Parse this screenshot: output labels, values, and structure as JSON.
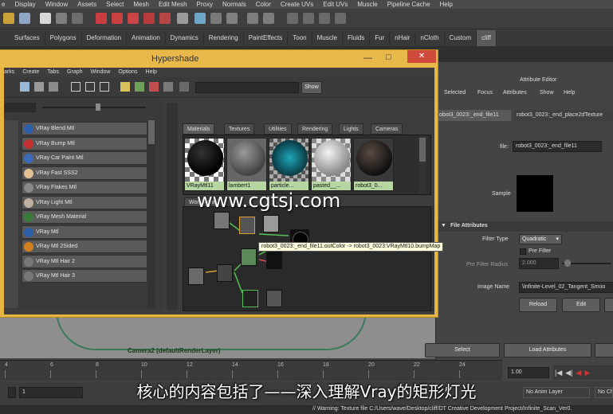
{
  "menubar": [
    "e",
    "Display",
    "Window",
    "Assets",
    "Select",
    "Mesh",
    "Edit Mesh",
    "Proxy",
    "Normals",
    "Color",
    "Create UVs",
    "Edit UVs",
    "Muscle",
    "Pipeline Cache",
    "Help"
  ],
  "shelf_tabs": [
    "Surfaces",
    "Polygons",
    "Deformation",
    "Animation",
    "Dynamics",
    "Rendering",
    "PaintEffects",
    "Toon",
    "Muscle",
    "Fluids",
    "Fur",
    "nHair",
    "nCloth",
    "Custom",
    "cliff"
  ],
  "hypershade": {
    "title": "Hypershade",
    "menu": [
      "arks",
      "Create",
      "Tabs",
      "Graph",
      "Window",
      "Options",
      "Help"
    ],
    "show_button": "Show",
    "create_items": [
      "VRay Blend Mtl",
      "VRay Bump Mtl",
      "VRay Car Paint Mtl",
      "VRay Fast SSS2",
      "VRay Flakes Mtl",
      "VRay Light Mtl",
      "VRay Mesh Material",
      "VRay Mtl",
      "VRay Mtl 2Sided",
      "VRay Mtl Hair 2",
      "VRay Mtl Hair 3"
    ],
    "tabs": [
      "Materials",
      "Textures",
      "Utilities",
      "Rendering",
      "Lights",
      "Cameras"
    ],
    "swatches": [
      "VRayMtl11",
      "lambert1",
      "particle...",
      "pasted__...",
      "robot3_0..."
    ],
    "work_area_tab": "Work Area",
    "tooltip": "robot3_0023:_end_file11.outColor -> robot3_0023:VRayMtl10.bumpMap"
  },
  "attribute_editor": {
    "title": "Attribute Editor",
    "menu": [
      "Selected",
      "Focus",
      "Attributes",
      "Show",
      "Help"
    ],
    "tabs": [
      "obot3_0023:_end_file11",
      "robot3_0023:_end_place2dTexture"
    ],
    "file_label": "file:",
    "file_value": "robot3_0023:_end_file11",
    "sample_label": "Sample",
    "section": "File Attributes",
    "filter_type_label": "Filter Type",
    "filter_type_value": "Quadratic",
    "pre_filter_label": "Pre Filter",
    "pre_filter_radius_label": "Pre Filter Radius",
    "pre_filter_radius_value": "2.000",
    "image_name_label": "Image Name",
    "image_name_value": "\\Infinite-Level_02_Tangent_Smoo",
    "reload": "Reload",
    "edit": "Edit",
    "select": "Select",
    "load_attributes": "Load Attributes"
  },
  "viewport": {
    "camera_label": "Camera2 (defaultRenderLayer)"
  },
  "timeline": {
    "ticks": [
      "4",
      "6",
      "8",
      "10",
      "12",
      "14",
      "16",
      "18",
      "20",
      "22",
      "24"
    ],
    "current_frame": "1.00",
    "range_start": "1",
    "anim_layer": "No Anim Layer",
    "char_set": "No Ch"
  },
  "command_line": "// Warning: Texture file C:/Users/wave/Desktop/cliff/DT Creative Development Project/Infinite_Scan_Ver0.",
  "subtitle": "核心的内容包括了——深入理解Vray的矩形灯光",
  "watermark": "www.cgtsj.com",
  "colors": {
    "hypershade_frame": "#e6b544",
    "swatch_caption": "#b7d7a2",
    "tooltip": "#ffffe0"
  }
}
